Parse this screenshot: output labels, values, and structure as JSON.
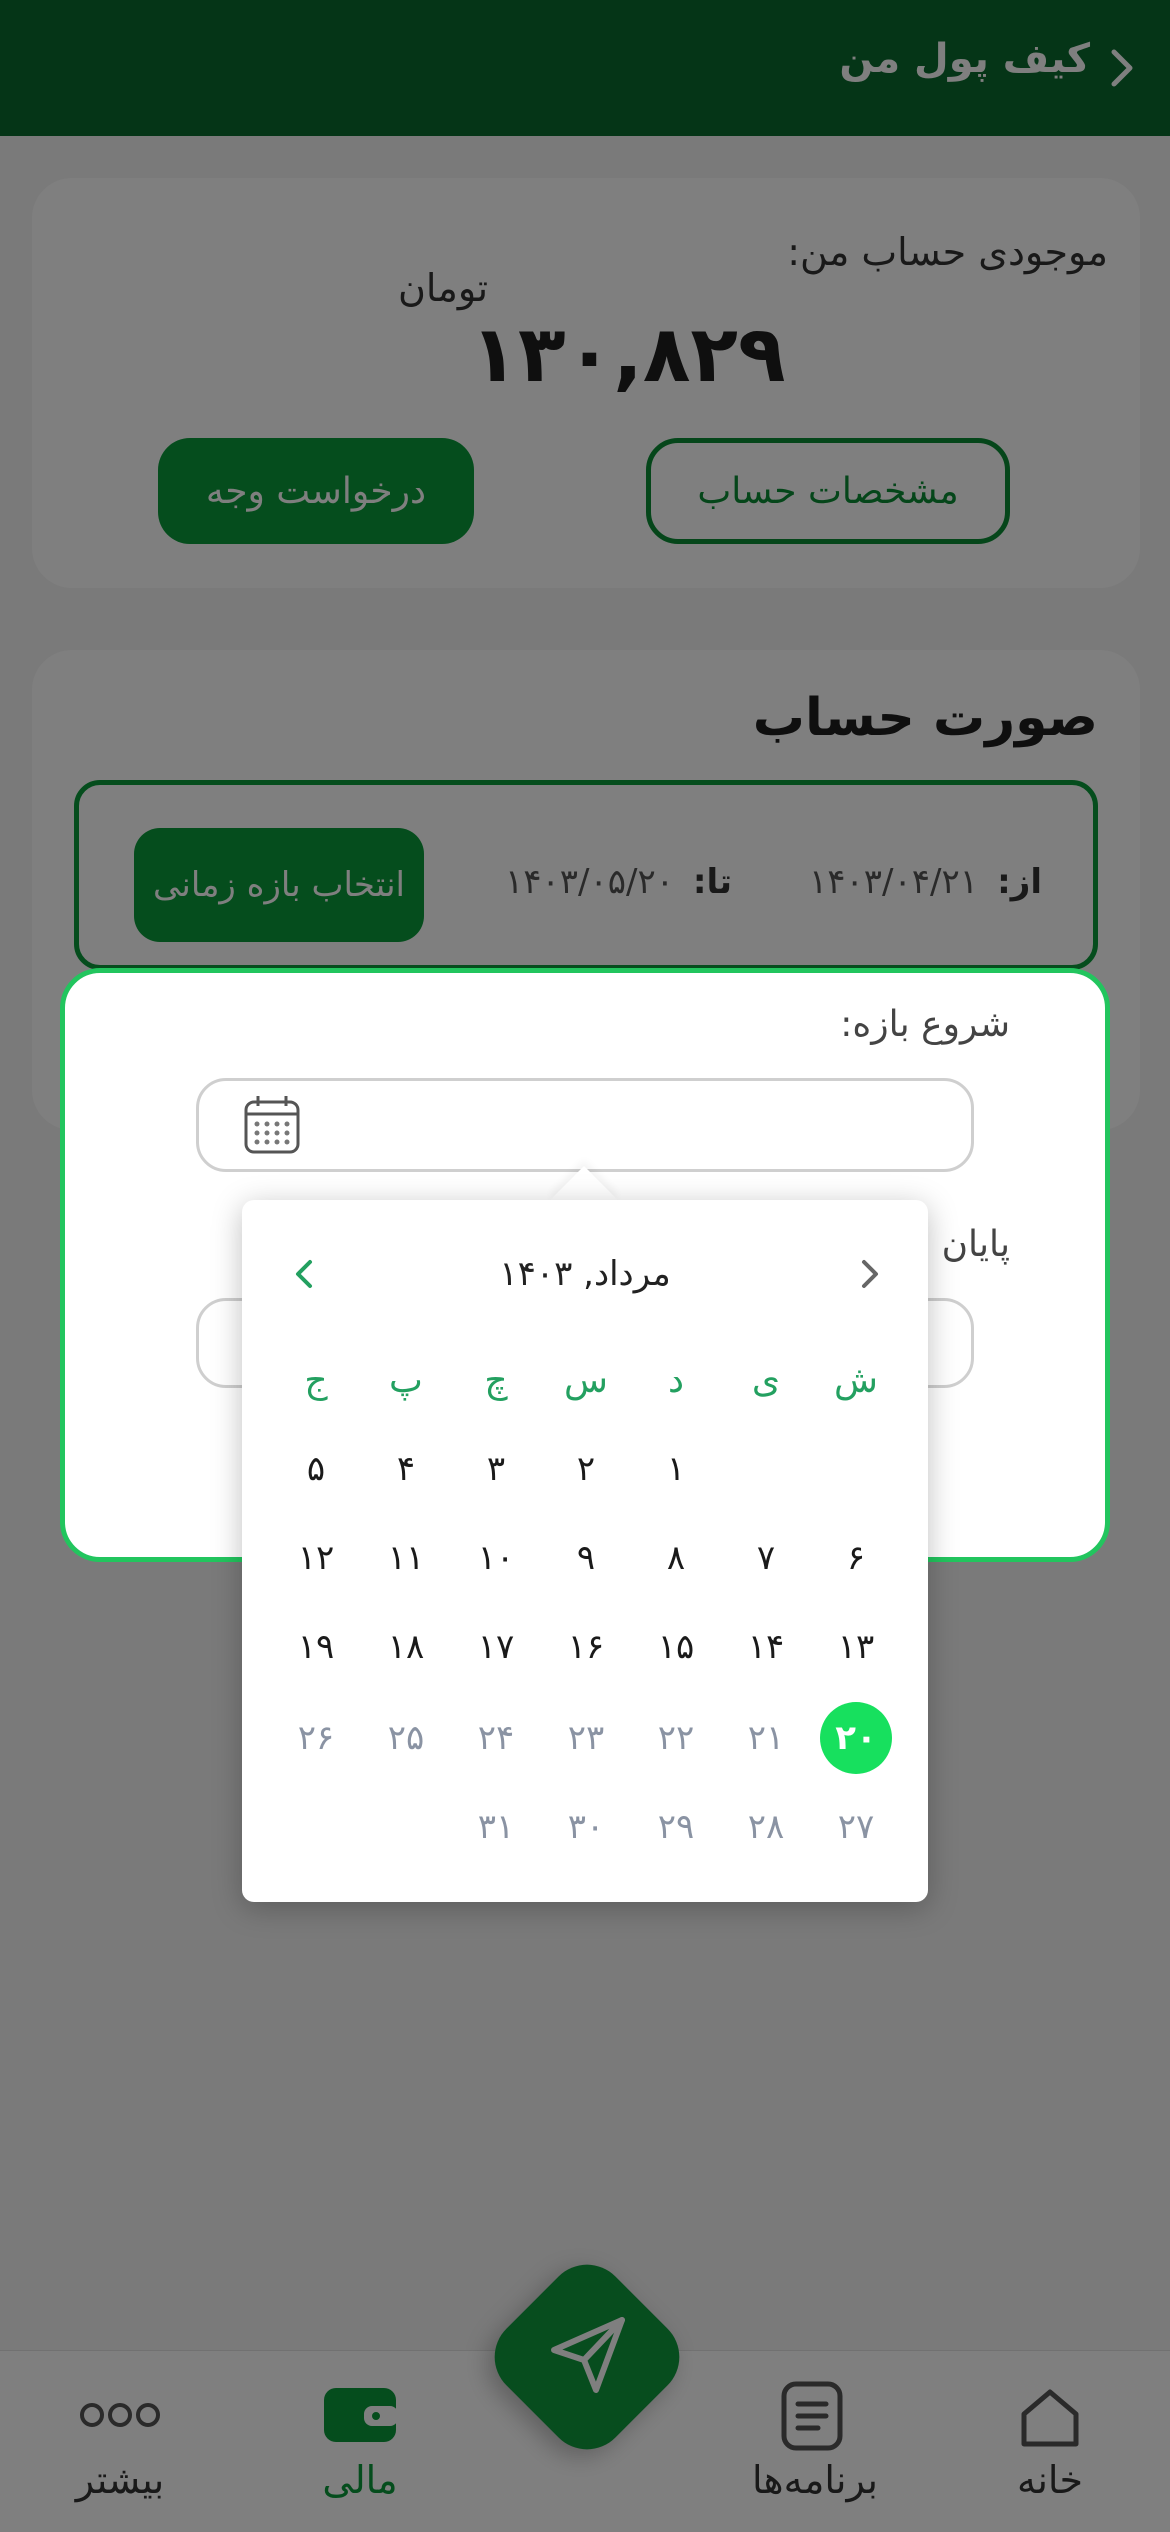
{
  "header": {
    "title": "کیف پول من"
  },
  "balance": {
    "label": "موجودی حساب من:",
    "unit": "تومان",
    "amount": "۱۳۰,۸۲۹",
    "details_button": "مشخصات حساب",
    "withdraw_button": "درخواست وجه"
  },
  "statement": {
    "title": "صورت حساب",
    "from_label": "از:",
    "from_value": "۱۴۰۳/۰۴/۲۱",
    "to_label": "تا:",
    "to_value": "۱۴۰۳/۰۵/۲۰",
    "select_range_button": "انتخاب بازه زمانی"
  },
  "modal": {
    "start_label": "شروع بازه:",
    "end_label": "پایان"
  },
  "picker": {
    "title": "مرداد, ۱۴۰۳",
    "weekdays": [
      "ش",
      "ی",
      "د",
      "س",
      "چ",
      "پ",
      "ج"
    ],
    "days": [
      "۱",
      "۲",
      "۳",
      "۴",
      "۵",
      "۶",
      "۷",
      "۸",
      "۹",
      "۱۰",
      "۱۱",
      "۱۲",
      "۱۳",
      "۱۴",
      "۱۵",
      "۱۶",
      "۱۷",
      "۱۸",
      "۱۹",
      "۲۰",
      "۲۱",
      "۲۲",
      "۲۳",
      "۲۴",
      "۲۵",
      "۲۶",
      "۲۷",
      "۲۸",
      "۲۹",
      "۳۰",
      "۳۱"
    ],
    "selected_day": "۲۰"
  },
  "nav": {
    "home": "خانه",
    "programs": "برنامه‌ها",
    "finance": "مالی",
    "more": "بیشتر"
  },
  "colors": {
    "brand_dark": "#0b6b2f",
    "brand": "#0b9b3a",
    "selected_day": "#17e05e",
    "weekday": "#23a060"
  },
  "icons": [
    "chevron-left-icon",
    "calendar-icon",
    "home-icon",
    "document-icon",
    "wallet-icon",
    "more-dots-icon",
    "send-icon"
  ]
}
